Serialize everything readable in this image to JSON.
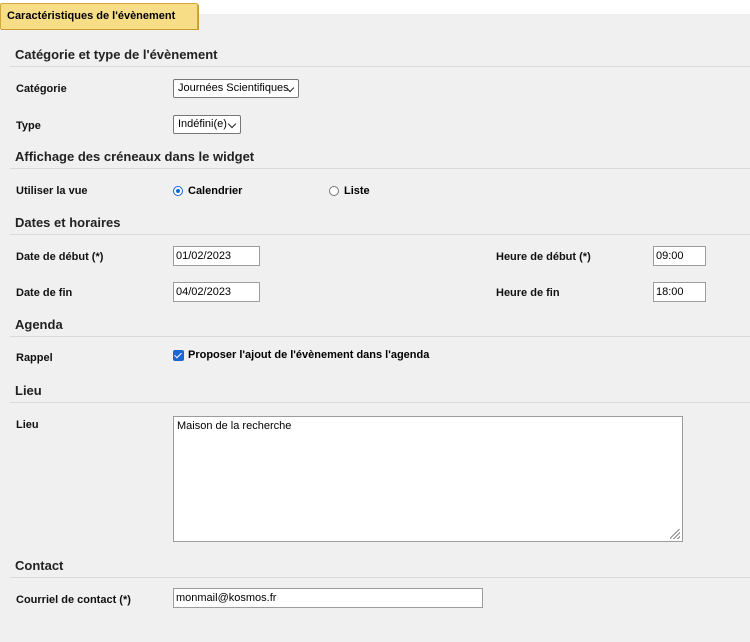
{
  "tab": {
    "label": "Caractéristiques de l'évènement"
  },
  "sections": {
    "category": "Catégorie et type de l'évènement",
    "widget": "Affichage des créneaux dans le widget",
    "dates": "Dates et horaires",
    "agenda": "Agenda",
    "lieu": "Lieu",
    "contact": "Contact"
  },
  "category": {
    "categorie_label": "Catégorie",
    "categorie_value": "Journées Scientifiques",
    "type_label": "Type",
    "type_value": "Indéfini(e)"
  },
  "widget": {
    "vue_label": "Utiliser la vue",
    "options": [
      "Calendrier",
      "Liste"
    ],
    "selected": "Calendrier"
  },
  "dates": {
    "debut_label": "Date de début (*)",
    "debut_value": "01/02/2023",
    "fin_label": "Date de fin",
    "fin_value": "04/02/2023",
    "heure_debut_label": "Heure de début (*)",
    "heure_debut_value": "09:00",
    "heure_fin_label": "Heure de fin",
    "heure_fin_value": "18:00"
  },
  "agenda": {
    "rappel_label": "Rappel",
    "checkbox_label": "Proposer l'ajout de l'évènement dans l'agenda",
    "checked": true
  },
  "lieu": {
    "label": "Lieu",
    "value": "Maison de la recherche"
  },
  "contact": {
    "label": "Courriel de contact (*)",
    "value": "monmail@kosmos.fr"
  },
  "colors": {
    "tab_bg": "#f8dd87",
    "accent": "#1b66d2",
    "panel_bg": "#f0f0f0"
  }
}
